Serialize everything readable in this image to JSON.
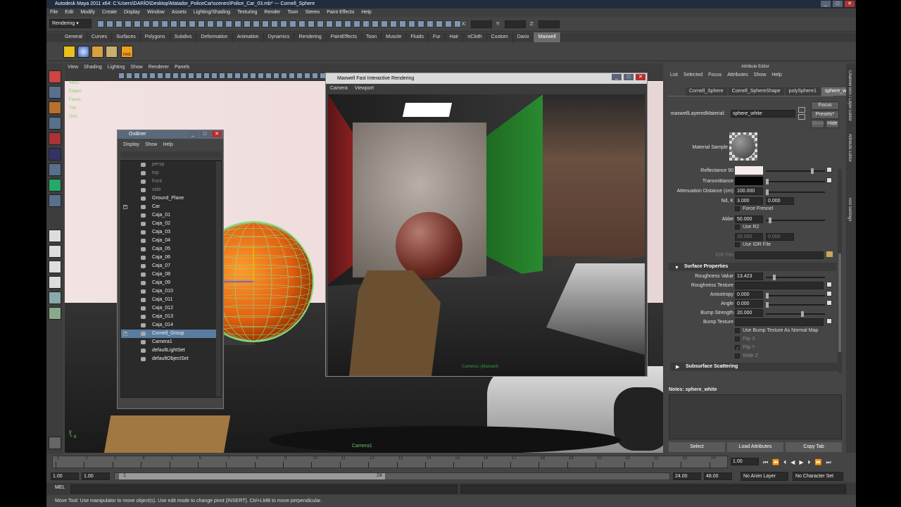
{
  "window": {
    "title": "Autodesk Maya 2011 x64: C:\\Users\\DARÍO\\Desktop\\Matador_PoliceCar\\scenes\\Police_Car_03.mb* --- Cornell_Sphere"
  },
  "menubar": [
    "File",
    "Edit",
    "Modify",
    "Create",
    "Display",
    "Window",
    "Assets",
    "Lighting/Shading",
    "Texturing",
    "Render",
    "Toon",
    "Stereo",
    "Paint Effects",
    "Help"
  ],
  "statusline": {
    "mode": "Rendering",
    "x_label": "X:",
    "y_label": "Y:",
    "z_label": "Z:"
  },
  "shelf_tabs": [
    "General",
    "Curves",
    "Surfaces",
    "Polygons",
    "Subdivs",
    "Deformation",
    "Animation",
    "Dynamics",
    "Rendering",
    "PaintEffects",
    "Toon",
    "Muscle",
    "Fluids",
    "Fur",
    "Hair",
    "nCloth",
    "Custom",
    "Dario",
    "Maxwell"
  ],
  "shelf_active": "Maxwell",
  "shelf_icon_labels": [
    "FIRE"
  ],
  "viewport": {
    "menu": [
      "View",
      "Shading",
      "Lighting",
      "Show",
      "Renderer",
      "Panels"
    ],
    "hud_labels": [
      "Verts:",
      "Edges:",
      "Faces:",
      "Tris:",
      "UVs:"
    ],
    "camera_label": "Camera1"
  },
  "outliner": {
    "title": "Outliner",
    "menu": [
      "Display",
      "Show",
      "Help"
    ],
    "items": [
      {
        "label": "persp",
        "dim": true
      },
      {
        "label": "top",
        "dim": true
      },
      {
        "label": "front",
        "dim": true
      },
      {
        "label": "side",
        "dim": true
      },
      {
        "label": "Ground_Plane"
      },
      {
        "label": "Car",
        "expand": true
      },
      {
        "label": "Caja_01"
      },
      {
        "label": "Caja_02"
      },
      {
        "label": "Caja_03"
      },
      {
        "label": "Caja_04"
      },
      {
        "label": "Caja_05"
      },
      {
        "label": "Caja_06"
      },
      {
        "label": "Caja_07"
      },
      {
        "label": "Caja_08"
      },
      {
        "label": "Caja_09"
      },
      {
        "label": "Caja_010"
      },
      {
        "label": "Caja_011"
      },
      {
        "label": "Caja_012"
      },
      {
        "label": "Caja_013"
      },
      {
        "label": "Caja_014"
      },
      {
        "label": "Cornell_Group",
        "expand": true,
        "selected": true
      },
      {
        "label": "Camera1"
      },
      {
        "label": "defaultLightSet"
      },
      {
        "label": "defaultObjectSet"
      }
    ]
  },
  "maxwell": {
    "title": "Maxwell Fast Interactive Rendering",
    "menu": [
      "Camera",
      "Viewport"
    ],
    "camera_overlay": "Camera1 (Maxwell)"
  },
  "attribute_editor": {
    "title": "Attribute Editor",
    "menu": [
      "List",
      "Selected",
      "Focus",
      "Attributes",
      "Show",
      "Help"
    ],
    "tabs": [
      "Cornell_Sphere",
      "Cornell_SphereShape",
      "polySphere1",
      "sphere_white"
    ],
    "active_tab": "sphere_white",
    "material_label": "maxwellLayeredMaterial:",
    "material_value": "sphere_white",
    "focus_btn": "Focus",
    "presets_btn": "Presets*",
    "show_btn": "Show",
    "hide_btn": "Hide",
    "material_sample_label": "Material Sample",
    "reflectance_label": "Reflectance 90",
    "transmittance_label": "Transmittance",
    "atten_label": "Attenuation Distance (cm)",
    "atten_value": "100.000",
    "nd_label": "Nd, K",
    "nd_value": "3.000",
    "k_value": "0.000",
    "force_fresnel": "Force Fresnel",
    "abbe_label": "Abbe",
    "abbe_value": "50.000",
    "use_r2": "Use R2",
    "r2_a": "28.000",
    "r2_b": "0.000",
    "use_ior": "Use IOR File",
    "ior_label": "IOR File",
    "surface_section": "Surface Properties",
    "roughness_label": "Roughness Value",
    "roughness_value": "13.423",
    "roughness_tex_label": "Roughness Texture",
    "anisotropy_label": "Anisotropy",
    "anisotropy_value": "0.000",
    "angle_label": "Angle",
    "angle_value": "0.000",
    "bump_strength_label": "Bump Strength",
    "bump_strength_value": "20.000",
    "bump_tex_label": "Bump Texture",
    "use_bump_normal": "Use Bump Texture As Normal Map",
    "flip_x": "Flip X",
    "flip_y": "Flip Y",
    "wide_z": "Wide Z",
    "subsurface_section": "Subsurface Scattering",
    "notes_label": "Notes:  sphere_white",
    "select_btn": "Select",
    "load_btn": "Load Attributes",
    "copy_btn": "Copy Tab",
    "colors": {
      "reflectance": "#f5eceb",
      "transmittance": "#050505"
    }
  },
  "right_tabs": [
    "Channel Box / Layer Editor",
    "Attribute Editor",
    "Tool Settings"
  ],
  "timeline": {
    "ticks": [
      "1",
      "2",
      "3",
      "4",
      "5",
      "6",
      "7",
      "8",
      "9",
      "10",
      "11",
      "12",
      "13",
      "14",
      "15",
      "16",
      "17",
      "18",
      "19",
      "20",
      "21",
      "22",
      "23",
      "24"
    ],
    "current_frame": "1.00"
  },
  "range": {
    "start": "1.00",
    "start2": "1.00",
    "slider_start": "1",
    "slider_end": "24",
    "end": "24.00",
    "end2": "48.00",
    "anim_layer": "No Anim Layer",
    "char_set": "No Character Set"
  },
  "cmdline": {
    "label": "MEL"
  },
  "helpline": "Move Tool: Use manipulator to move object(s). Use edit mode to change pivot (INSERT). Ctrl+LMB to move perpendicular."
}
